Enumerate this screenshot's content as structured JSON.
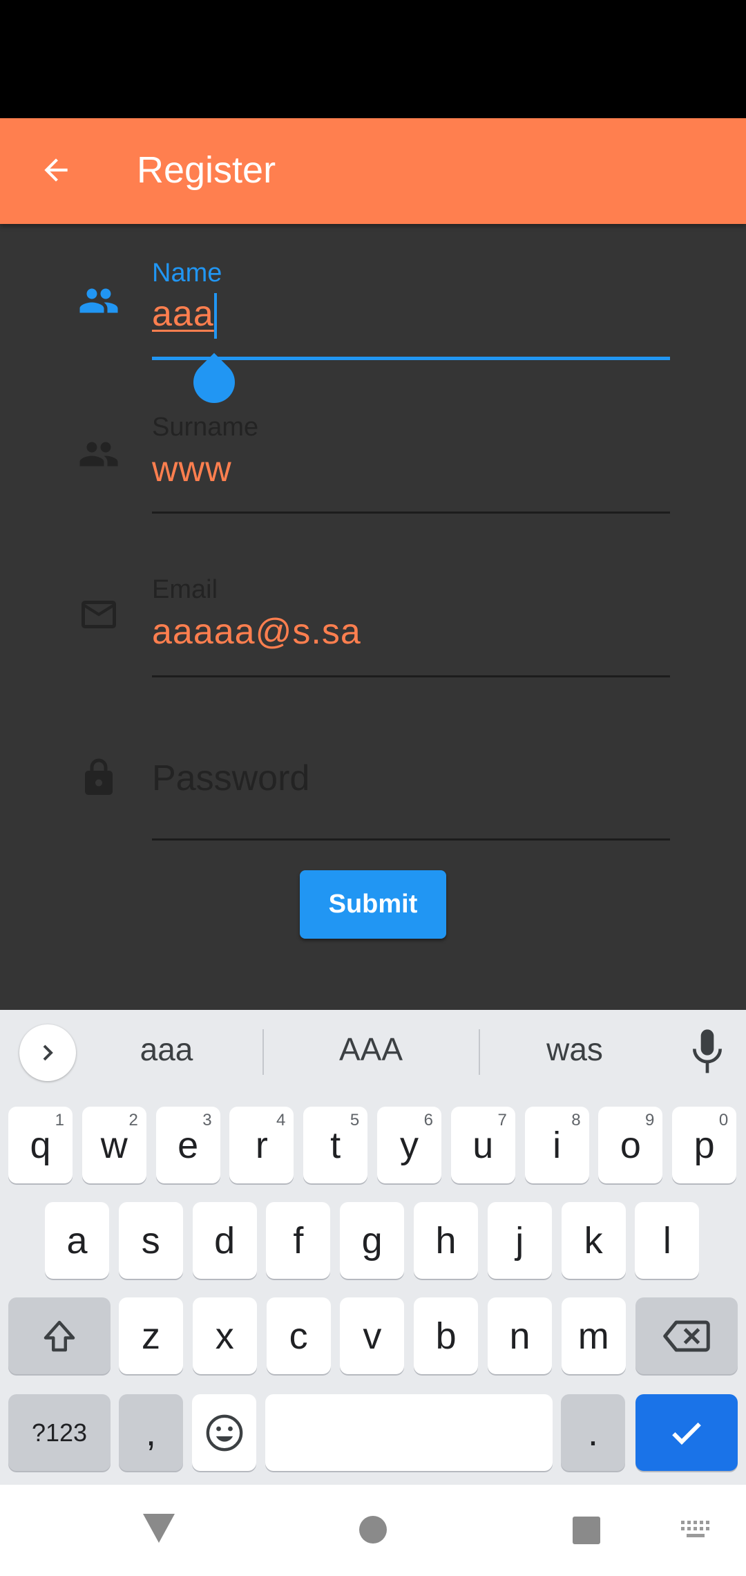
{
  "app_bar": {
    "title": "Register",
    "color": "#FF7F4F"
  },
  "form": {
    "name": {
      "label": "Name",
      "value": "aaa"
    },
    "surname": {
      "label": "Surname",
      "value": "www"
    },
    "email": {
      "label": "Email",
      "value": "aaaaa@s.sa"
    },
    "password": {
      "placeholder": "Password"
    },
    "submit_label": "Submit"
  },
  "keyboard": {
    "suggestions": [
      "aaa",
      "AAA",
      "was"
    ],
    "row1": [
      {
        "k": "q",
        "h": "1"
      },
      {
        "k": "w",
        "h": "2"
      },
      {
        "k": "e",
        "h": "3"
      },
      {
        "k": "r",
        "h": "4"
      },
      {
        "k": "t",
        "h": "5"
      },
      {
        "k": "y",
        "h": "6"
      },
      {
        "k": "u",
        "h": "7"
      },
      {
        "k": "i",
        "h": "8"
      },
      {
        "k": "o",
        "h": "9"
      },
      {
        "k": "p",
        "h": "0"
      }
    ],
    "row2": [
      "a",
      "s",
      "d",
      "f",
      "g",
      "h",
      "j",
      "k",
      "l"
    ],
    "row3": [
      "z",
      "x",
      "c",
      "v",
      "b",
      "n",
      "m"
    ],
    "sym_label": "?123",
    "comma": ",",
    "period": "."
  },
  "colors": {
    "accent": "#2196F3",
    "brand": "#FF7F4F",
    "keyboard_action": "#1A73E8"
  }
}
